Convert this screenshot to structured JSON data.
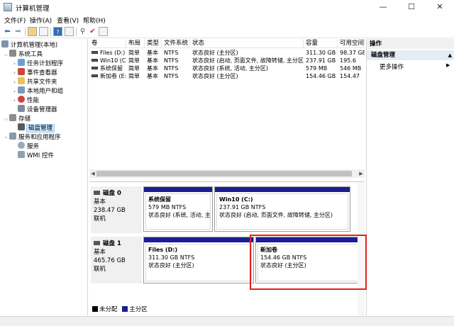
{
  "window": {
    "title": "计算机管理",
    "minimize": "—",
    "maximize": "☐",
    "close": "✕"
  },
  "menu": [
    "文件(F)",
    "操作(A)",
    "查看(V)",
    "帮助(H)"
  ],
  "tree": {
    "root": "计算机管理(本地)",
    "system_tools": "系统工具",
    "task_scheduler": "任务计划程序",
    "event_viewer": "事件查看器",
    "shared_folders": "共享文件夹",
    "local_users": "本地用户和组",
    "performance": "性能",
    "device_manager": "设备管理器",
    "storage": "存储",
    "disk_management": "磁盘管理",
    "services_apps": "服务和应用程序",
    "services": "服务",
    "wmi": "WMI 控件"
  },
  "columns": [
    "卷",
    "布局",
    "类型",
    "文件系统",
    "状态",
    "容量",
    "可用空间"
  ],
  "volumes": [
    {
      "name": "Files (D:)",
      "layout": "简单",
      "type": "基本",
      "fs": "NTFS",
      "status": "状态良好 (主分区)",
      "capacity": "311.30 GB",
      "free": "98.37 GB"
    },
    {
      "name": "Win10 (C:)",
      "layout": "简单",
      "type": "基本",
      "fs": "NTFS",
      "status": "状态良好 (启动, 页面文件, 故障转储, 主分区)",
      "capacity": "237.91 GB",
      "free": "195.6"
    },
    {
      "name": "系统保留",
      "layout": "简单",
      "type": "基本",
      "fs": "NTFS",
      "status": "状态良好 (系统, 活动, 主分区)",
      "capacity": "579 MB",
      "free": "546 MB"
    },
    {
      "name": "新加卷 (E:)",
      "layout": "简单",
      "type": "基本",
      "fs": "NTFS",
      "status": "状态良好 (主分区)",
      "capacity": "154.46 GB",
      "free": "154.47"
    }
  ],
  "disks": [
    {
      "name": "磁盘 0",
      "kind": "基本",
      "size": "238.47 GB",
      "state": "联机",
      "partitions": [
        {
          "name": "系统保留",
          "size": "579 MB NTFS",
          "status": "状态良好 (系统, 活动, 主分"
        },
        {
          "name": "Win10  (C:)",
          "size": "237.91 GB NTFS",
          "status": "状态良好 (启动, 页面文件, 故障转储, 主分区)"
        }
      ]
    },
    {
      "name": "磁盘 1",
      "kind": "基本",
      "size": "465.76 GB",
      "state": "联机",
      "partitions": [
        {
          "name": "Files  (D:)",
          "size": "311.30 GB NTFS",
          "status": "状态良好 (主分区)"
        },
        {
          "name": "新加卷",
          "size": "154.46 GB NTFS",
          "status": "状态良好 (主分区)"
        }
      ]
    }
  ],
  "legend": {
    "unallocated": "未分配",
    "primary": "主分区"
  },
  "actions": {
    "header": "操作",
    "section": "磁盘管理",
    "more": "更多操作"
  },
  "colors": {
    "primary_partition": "#1c1e93",
    "unallocated": "#000000",
    "highlight": "#e0221f"
  }
}
